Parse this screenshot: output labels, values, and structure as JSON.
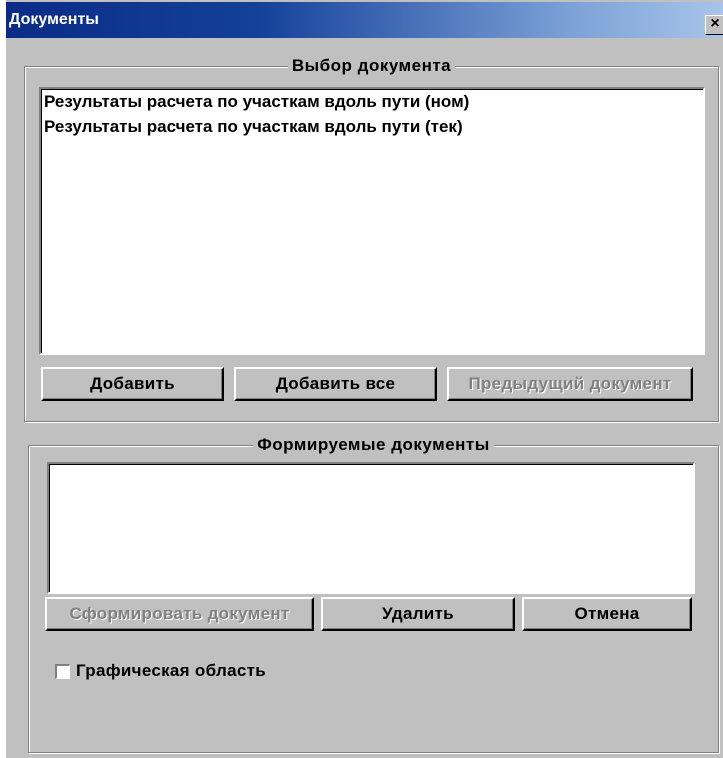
{
  "window": {
    "title": "Документы",
    "close_glyph": "×"
  },
  "select_group": {
    "label": "Выбор документа",
    "items": [
      "Результаты расчета по участкам вдоль пути (ном)",
      "Результаты расчета по участкам вдоль пути (тек)"
    ],
    "buttons": {
      "add": "Добавить",
      "add_all": "Добавить все",
      "previous": "Предыдущий документ"
    }
  },
  "formed_group": {
    "label": "Формируемые документы",
    "items": [],
    "buttons": {
      "form": "Сформировать документ",
      "delete": "Удалить",
      "cancel": "Отмена"
    }
  },
  "graphics_checkbox": {
    "label": "Графическая область",
    "checked": false
  }
}
